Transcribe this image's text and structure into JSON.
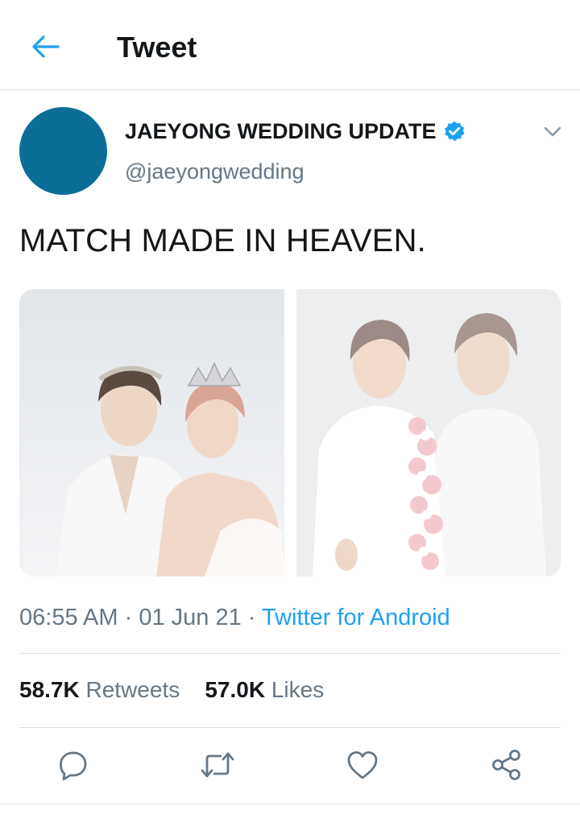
{
  "header": {
    "title": "Tweet",
    "back_icon": "arrow-left-icon"
  },
  "tweet": {
    "display_name": "JAEYONG WEDDING UPDATE",
    "handle": "@jaeyongwedding",
    "verified": true,
    "text": "MATCH MADE IN HEAVEN.",
    "time": "06:55 AM",
    "date": "01 Jun 21",
    "source": "Twitter for Android",
    "separator": "·",
    "media_count": 2
  },
  "stats": {
    "retweets_count": "58.7K",
    "retweets_label": "Retweets",
    "likes_count": "57.0K",
    "likes_label": "Likes"
  },
  "actions": [
    "reply-icon",
    "retweet-icon",
    "like-icon",
    "share-icon"
  ],
  "colors": {
    "accent": "#1da1f2",
    "text": "#14171a",
    "secondary": "#657786",
    "divider": "#d9dee3",
    "avatar": "#0b6e97"
  }
}
